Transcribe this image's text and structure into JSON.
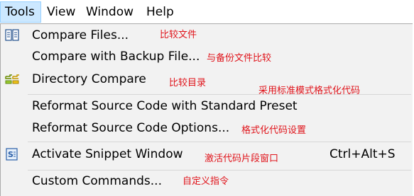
{
  "menubar": {
    "items": [
      {
        "label": "Tools",
        "active": true
      },
      {
        "label": "View",
        "active": false
      },
      {
        "label": "Window",
        "active": false
      },
      {
        "label": "Help",
        "active": false
      }
    ]
  },
  "menu": {
    "items": [
      {
        "label": "Compare Files...",
        "icon": "compare-files-icon"
      },
      {
        "label": "Compare with Backup File..."
      },
      {
        "label": "Directory Compare",
        "icon": "directory-compare-icon"
      },
      {
        "label": "Reformat Source Code with Standard Preset"
      },
      {
        "label": "Reformat Source Code Options..."
      },
      {
        "label": "Activate Snippet Window",
        "icon": "snippet-window-icon",
        "shortcut": "Ctrl+Alt+S"
      },
      {
        "label": "Custom Commands..."
      }
    ]
  },
  "annotations": {
    "compare_files": "比较文件",
    "compare_backup": "与备份文件比较",
    "directory_compare": "比较目录",
    "reformat_standard": "采用标准模式格式化代码",
    "reformat_options": "格式化代码设置",
    "snippet_window": "激活代码片段窗口",
    "custom_commands": "自定义指令"
  },
  "colors": {
    "menu_bg": "#f2f2f2",
    "menubar_active_bg": "#cce8ff",
    "annotation_text": "#e0141b",
    "separator": "#d7d7d7"
  }
}
